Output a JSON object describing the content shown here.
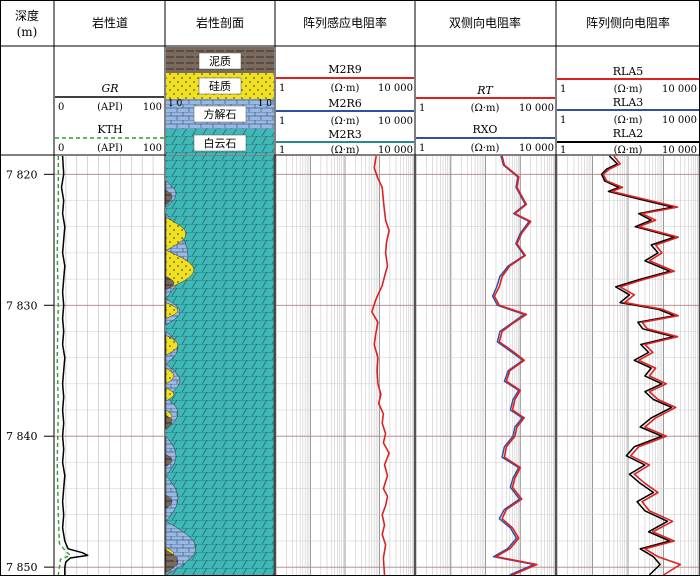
{
  "chart_data": {
    "type": "line",
    "depth_axis": {
      "label": "深度\n(m)",
      "ticks": [
        "7 820",
        "7 830",
        "7 840",
        "7 850"
      ],
      "range": [
        7818.6,
        7850.6
      ]
    },
    "tracks": [
      {
        "title": "岩性道",
        "curves": [
          {
            "name": "GR",
            "unit": "(API)",
            "min": "0",
            "max": "100",
            "color": "#000000",
            "style": "solid",
            "points": [
              [
                7818.6,
                7
              ],
              [
                7820,
                8
              ],
              [
                7821,
                6
              ],
              [
                7822,
                8
              ],
              [
                7823,
                7
              ],
              [
                7824,
                9
              ],
              [
                7825,
                8
              ],
              [
                7826,
                7
              ],
              [
                7827,
                9
              ],
              [
                7828,
                8
              ],
              [
                7829,
                7
              ],
              [
                7830,
                8
              ],
              [
                7831,
                7
              ],
              [
                7832,
                8
              ],
              [
                7833,
                7
              ],
              [
                7834,
                9
              ],
              [
                7835,
                8
              ],
              [
                7836,
                7
              ],
              [
                7837,
                8
              ],
              [
                7838,
                7
              ],
              [
                7839,
                8
              ],
              [
                7840,
                7
              ],
              [
                7841,
                8
              ],
              [
                7842,
                7
              ],
              [
                7843,
                9
              ],
              [
                7844,
                8
              ],
              [
                7845,
                7
              ],
              [
                7846,
                8
              ],
              [
                7847,
                7
              ],
              [
                7848,
                9
              ],
              [
                7848.6,
                12
              ],
              [
                7848.9,
                25
              ],
              [
                7849.1,
                30
              ],
              [
                7849.3,
                14
              ],
              [
                7849.6,
                10
              ],
              [
                7850,
                9
              ],
              [
                7850.6,
                9
              ]
            ]
          },
          {
            "name": "KTH",
            "unit": "(API)",
            "min": "0",
            "max": "100",
            "color": "#2ca02c",
            "style": "dashed",
            "points": [
              [
                7818.6,
                3
              ],
              [
                7822,
                3
              ],
              [
                7826,
                2
              ],
              [
                7830,
                3
              ],
              [
                7834,
                2
              ],
              [
                7838,
                3
              ],
              [
                7842,
                2
              ],
              [
                7846,
                3
              ],
              [
                7848.2,
                4
              ],
              [
                7848.8,
                10
              ],
              [
                7849.1,
                14
              ],
              [
                7849.4,
                5
              ],
              [
                7850.6,
                3
              ]
            ]
          }
        ]
      },
      {
        "title": "岩性剖面",
        "legend": [
          "泥质",
          "硅质",
          "方解石",
          "白云石"
        ],
        "colors": {
          "mud": "#7a6a5e",
          "sil": "#f0e020",
          "cal": "#9ab8e0",
          "dol": "#40b8b8"
        }
      },
      {
        "title": "阵列感应电阻率",
        "scale": "log",
        "curves": [
          {
            "name": "M2R9",
            "unit": "(Ω·m)",
            "min": "1",
            "max": "10 000",
            "color": "#e02020"
          },
          {
            "name": "M2R6",
            "unit": "(Ω·m)",
            "min": "1",
            "max": "10 000",
            "color": "#3050a0"
          },
          {
            "name": "M2R3",
            "unit": "(Ω·m)",
            "min": "1",
            "max": "10 000",
            "color": "#2a8a8a"
          }
        ]
      },
      {
        "title": "双侧向电阻率",
        "scale": "log",
        "curves": [
          {
            "name": "RT",
            "unit": "(Ω·m)",
            "min": "1",
            "max": "10 000",
            "color": "#e02020"
          },
          {
            "name": "RXO",
            "unit": "(Ω·m)",
            "min": "1",
            "max": "10 000",
            "color": "#3050a0"
          }
        ]
      },
      {
        "title": "阵列侧向电阻率",
        "scale": "log",
        "curves": [
          {
            "name": "RLA5",
            "unit": "(Ω·m)",
            "min": "1",
            "max": "10 000",
            "color": "#e02020"
          },
          {
            "name": "RLA3",
            "unit": "(Ω·m)",
            "min": "1",
            "max": "10 000",
            "color": "#3050a0"
          },
          {
            "name": "RLA2",
            "unit": "(Ω·m)",
            "min": "1",
            "max": "10 000",
            "color": "#000000"
          }
        ]
      }
    ],
    "lithology_inset_ticks": [
      "1 0",
      "1 0"
    ],
    "induction_curve": [
      [
        7818.6,
        800
      ],
      [
        7819.5,
        700
      ],
      [
        7820.3,
        900
      ],
      [
        7821,
        1200
      ],
      [
        7822,
        1300
      ],
      [
        7822.8,
        1400
      ],
      [
        7823.5,
        1500
      ],
      [
        7824.3,
        1900
      ],
      [
        7825.2,
        1600
      ],
      [
        7826,
        1500
      ],
      [
        7827,
        1700
      ],
      [
        7827.5,
        1500
      ],
      [
        7828.5,
        1200
      ],
      [
        7829.5,
        800
      ],
      [
        7830.5,
        600
      ],
      [
        7831.3,
        900
      ],
      [
        7832,
        800
      ],
      [
        7833,
        700
      ],
      [
        7834,
        900
      ],
      [
        7835,
        850
      ],
      [
        7836,
        900
      ],
      [
        7836.8,
        1100
      ],
      [
        7837.5,
        950
      ],
      [
        7838.3,
        1300
      ],
      [
        7839,
        1200
      ],
      [
        7839.8,
        1500
      ],
      [
        7840.5,
        1300
      ],
      [
        7841.3,
        1900
      ],
      [
        7842.2,
        1400
      ],
      [
        7843,
        1700
      ],
      [
        7844,
        1300
      ],
      [
        7844.6,
        1700
      ],
      [
        7845.3,
        1500
      ],
      [
        7846,
        1200
      ],
      [
        7846.8,
        1400
      ],
      [
        7847.5,
        1200
      ],
      [
        7848.3,
        1500
      ],
      [
        7849.3,
        1300
      ],
      [
        7850.6,
        1400
      ]
    ],
    "laterolog_rt": [
      [
        7818.6,
        300
      ],
      [
        7819.3,
        350
      ],
      [
        7820.2,
        900
      ],
      [
        7821,
        800
      ],
      [
        7822.3,
        1500
      ],
      [
        7823,
        700
      ],
      [
        7823.6,
        2000
      ],
      [
        7824.5,
        1100
      ],
      [
        7825.3,
        800
      ],
      [
        7826.2,
        1400
      ],
      [
        7827,
        500
      ],
      [
        7827.8,
        300
      ],
      [
        7828.6,
        250
      ],
      [
        7829.3,
        180
      ],
      [
        7830,
        250
      ],
      [
        7830.7,
        1500
      ],
      [
        7831.4,
        600
      ],
      [
        7832,
        300
      ],
      [
        7832.8,
        250
      ],
      [
        7833.5,
        600
      ],
      [
        7834.2,
        1300
      ],
      [
        7835,
        500
      ],
      [
        7835.8,
        400
      ],
      [
        7836.5,
        1000
      ],
      [
        7837.2,
        700
      ],
      [
        7838,
        600
      ],
      [
        7838.6,
        1300
      ],
      [
        7839.3,
        800
      ],
      [
        7840,
        700
      ],
      [
        7840.8,
        400
      ],
      [
        7841.6,
        350
      ],
      [
        7842.4,
        1000
      ],
      [
        7843.2,
        700
      ],
      [
        7843.9,
        600
      ],
      [
        7844.8,
        1100
      ],
      [
        7845.6,
        400
      ],
      [
        7846.3,
        300
      ],
      [
        7847,
        600
      ],
      [
        7847.8,
        900
      ],
      [
        7848.6,
        500
      ],
      [
        7849.2,
        200
      ],
      [
        7849.8,
        3000
      ],
      [
        7850.6,
        600
      ]
    ],
    "laterolog_rxo": [
      [
        7818.6,
        280
      ],
      [
        7819.3,
        330
      ],
      [
        7820.2,
        850
      ],
      [
        7821,
        760
      ],
      [
        7822.3,
        1400
      ],
      [
        7823,
        650
      ],
      [
        7823.6,
        1800
      ],
      [
        7824.5,
        1000
      ],
      [
        7825.3,
        750
      ],
      [
        7826.2,
        1300
      ],
      [
        7827,
        450
      ],
      [
        7827.8,
        260
      ],
      [
        7828.6,
        210
      ],
      [
        7829.3,
        160
      ],
      [
        7830,
        220
      ],
      [
        7830.7,
        1300
      ],
      [
        7831.4,
        550
      ],
      [
        7832,
        260
      ],
      [
        7832.8,
        220
      ],
      [
        7833.5,
        520
      ],
      [
        7834.2,
        1200
      ],
      [
        7835,
        450
      ],
      [
        7835.8,
        350
      ],
      [
        7836.5,
        900
      ],
      [
        7837.2,
        620
      ],
      [
        7838,
        520
      ],
      [
        7838.6,
        1150
      ],
      [
        7839.3,
        700
      ],
      [
        7840,
        620
      ],
      [
        7840.8,
        350
      ],
      [
        7841.6,
        300
      ],
      [
        7842.4,
        900
      ],
      [
        7843.2,
        620
      ],
      [
        7843.9,
        520
      ],
      [
        7844.8,
        950
      ],
      [
        7845.6,
        350
      ],
      [
        7846.3,
        250
      ],
      [
        7847,
        520
      ],
      [
        7847.8,
        780
      ],
      [
        7848.6,
        430
      ],
      [
        7849.2,
        170
      ],
      [
        7849.8,
        2500
      ],
      [
        7850.6,
        500
      ]
    ],
    "array_lateral_rla5": [
      [
        7818.6,
        40
      ],
      [
        7819.2,
        60
      ],
      [
        7819.6,
        30
      ],
      [
        7820,
        20
      ],
      [
        7820.5,
        25
      ],
      [
        7821,
        70
      ],
      [
        7821.3,
        35
      ],
      [
        7821.8,
        200
      ],
      [
        7822.5,
        2500
      ],
      [
        7823,
        250
      ],
      [
        7823.5,
        600
      ],
      [
        7824,
        200
      ],
      [
        7824.8,
        2600
      ],
      [
        7825.4,
        600
      ],
      [
        7826,
        900
      ],
      [
        7826.6,
        400
      ],
      [
        7827.4,
        2000
      ],
      [
        7828,
        300
      ],
      [
        7828.6,
        60
      ],
      [
        7829.2,
        150
      ],
      [
        7829.8,
        80
      ],
      [
        7830.3,
        900
      ],
      [
        7830.8,
        2600
      ],
      [
        7831.3,
        250
      ],
      [
        7831.8,
        350
      ],
      [
        7832.4,
        2500
      ],
      [
        7833,
        300
      ],
      [
        7833.6,
        500
      ],
      [
        7834.2,
        200
      ],
      [
        7834.8,
        600
      ],
      [
        7835.4,
        400
      ],
      [
        7836,
        1200
      ],
      [
        7836.6,
        400
      ],
      [
        7837.2,
        700
      ],
      [
        7837.8,
        2200
      ],
      [
        7838.6,
        600
      ],
      [
        7839.3,
        300
      ],
      [
        7840,
        1200
      ],
      [
        7840.8,
        200
      ],
      [
        7841.5,
        120
      ],
      [
        7842.2,
        400
      ],
      [
        7842.9,
        150
      ],
      [
        7843.6,
        300
      ],
      [
        7844.3,
        700
      ],
      [
        7845,
        250
      ],
      [
        7845.7,
        400
      ],
      [
        7846.5,
        1800
      ],
      [
        7847.3,
        500
      ],
      [
        7848,
        2000
      ],
      [
        7848.6,
        300
      ],
      [
        7849.2,
        700
      ],
      [
        7849.8,
        3000
      ],
      [
        7850.6,
        1000
      ]
    ],
    "array_lateral_rla2": [
      [
        7818.6,
        30
      ],
      [
        7819.2,
        50
      ],
      [
        7819.6,
        25
      ],
      [
        7820,
        18
      ],
      [
        7820.5,
        22
      ],
      [
        7821,
        55
      ],
      [
        7821.3,
        28
      ],
      [
        7821.8,
        150
      ],
      [
        7822.5,
        1800
      ],
      [
        7823,
        200
      ],
      [
        7823.5,
        450
      ],
      [
        7824,
        160
      ],
      [
        7824.8,
        2000
      ],
      [
        7825.4,
        450
      ],
      [
        7826,
        700
      ],
      [
        7826.6,
        300
      ],
      [
        7827.4,
        1500
      ],
      [
        7828,
        230
      ],
      [
        7828.6,
        45
      ],
      [
        7829.2,
        110
      ],
      [
        7829.8,
        60
      ],
      [
        7830.3,
        700
      ],
      [
        7830.8,
        2000
      ],
      [
        7831.3,
        190
      ],
      [
        7831.8,
        260
      ],
      [
        7832.4,
        1900
      ],
      [
        7833,
        230
      ],
      [
        7833.6,
        380
      ],
      [
        7834.2,
        150
      ],
      [
        7834.8,
        450
      ],
      [
        7835.4,
        300
      ],
      [
        7836,
        900
      ],
      [
        7836.6,
        300
      ],
      [
        7837.2,
        520
      ],
      [
        7837.8,
        1700
      ],
      [
        7838.6,
        450
      ],
      [
        7839.3,
        220
      ],
      [
        7840,
        900
      ],
      [
        7840.8,
        150
      ],
      [
        7841.5,
        90
      ],
      [
        7842.2,
        300
      ],
      [
        7842.9,
        110
      ],
      [
        7843.6,
        220
      ],
      [
        7844.3,
        520
      ],
      [
        7845,
        180
      ],
      [
        7845.7,
        300
      ],
      [
        7846.5,
        1300
      ],
      [
        7847.3,
        380
      ],
      [
        7848,
        1500
      ],
      [
        7848.6,
        220
      ],
      [
        7849.2,
        520
      ],
      [
        7849.8,
        800
      ],
      [
        7850.6,
        400
      ]
    ]
  }
}
